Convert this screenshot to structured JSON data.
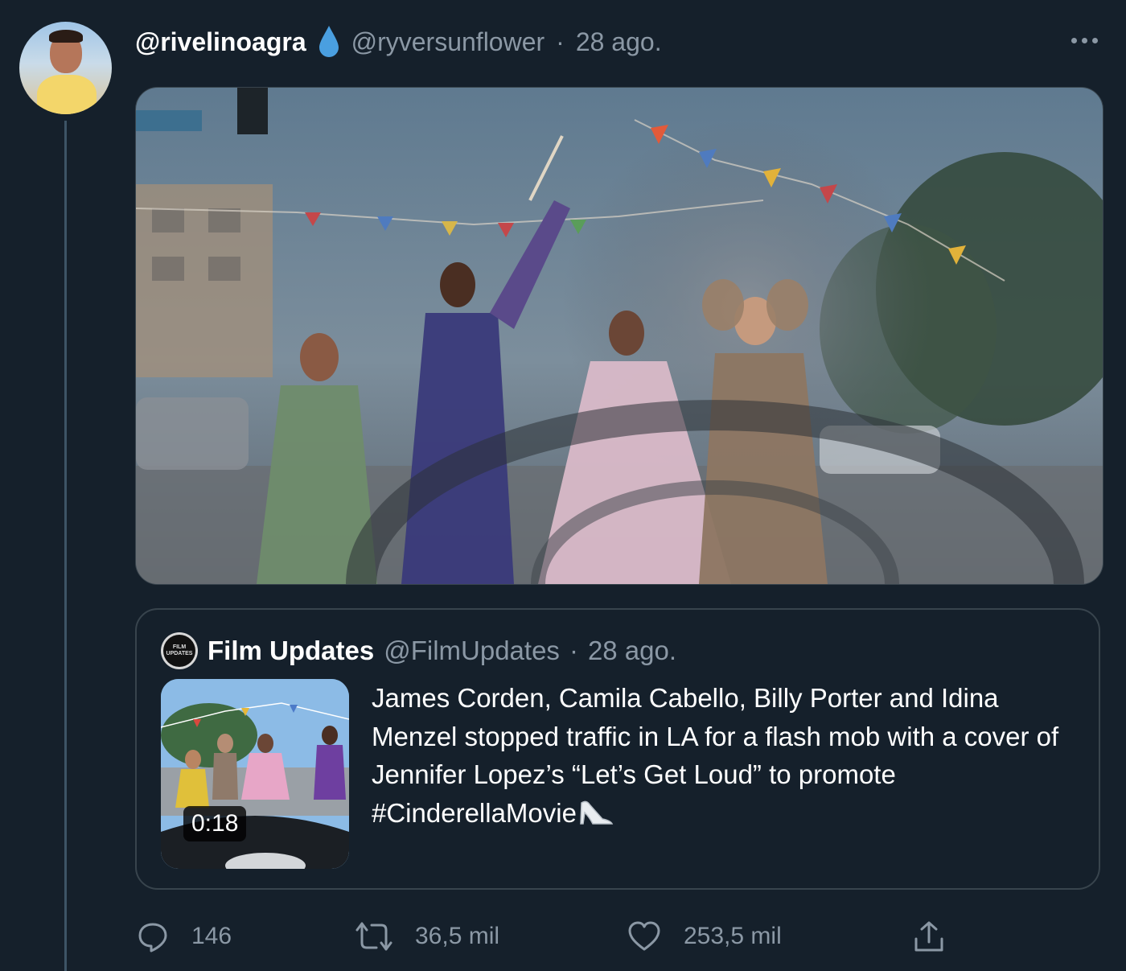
{
  "tweet": {
    "author_handle": "@rivelinoagra",
    "reply_to_handle": "@ryversunflower",
    "date": "28 ago.",
    "separator": "·",
    "media_alt": "video-still-flash-mob-car-window"
  },
  "quoted_tweet": {
    "name": "Film Updates",
    "handle": "@FilmUpdates",
    "date": "28 ago.",
    "separator": "·",
    "avatar_text": "FILM UPDATES",
    "video_duration": "0:18",
    "text": "James Corden, Camila Cabello, Billy Porter and Idina Menzel stopped traffic in LA for a flash mob with a cover of Jennifer Lopez’s “Let’s Get Loud” to promote #CinderellaMovie"
  },
  "actions": {
    "reply_count": "146",
    "retweet_count": "36,5 mil",
    "like_count": "253,5 mil"
  },
  "icons": {
    "verified_like": "water-drop-icon",
    "more": "more-horizontal-icon",
    "reply": "reply-icon",
    "retweet": "retweet-icon",
    "like": "heart-icon",
    "share": "share-icon",
    "emoji": "high-heel-shoe-icon"
  },
  "colors": {
    "background": "#15202b",
    "secondary_text": "#8b98a5",
    "border": "#38444d",
    "drop": "#4a9fe0"
  }
}
